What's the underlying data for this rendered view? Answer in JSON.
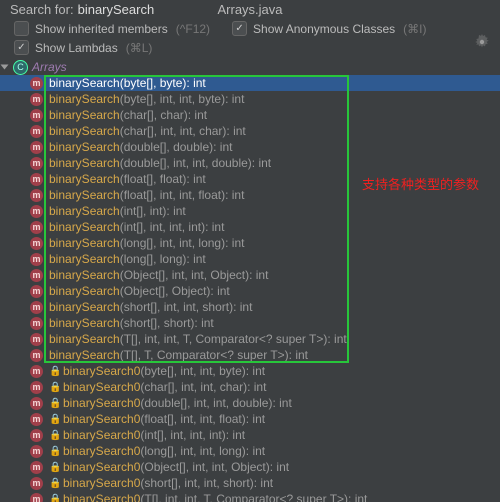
{
  "header": {
    "search_label": "Search for:",
    "search_value": "binarySearch",
    "file_name": "Arrays.java"
  },
  "options": {
    "show_inherited": {
      "label": "Show inherited members",
      "hint": "(^F12)",
      "checked": false
    },
    "show_lambdas": {
      "label": "Show Lambdas",
      "hint": "(⌘L)",
      "checked": true
    },
    "show_anonymous": {
      "label": "Show Anonymous Classes",
      "hint": "(⌘I)",
      "checked": true
    }
  },
  "class_name": "Arrays",
  "annotation": "支持各种类型的参数",
  "methods_group_a": [
    {
      "name": "binarySearch",
      "sig": "(byte[], byte): int",
      "selected": true
    },
    {
      "name": "binarySearch",
      "sig": "(byte[], int, int, byte): int"
    },
    {
      "name": "binarySearch",
      "sig": "(char[], char): int"
    },
    {
      "name": "binarySearch",
      "sig": "(char[], int, int, char): int"
    },
    {
      "name": "binarySearch",
      "sig": "(double[], double): int"
    },
    {
      "name": "binarySearch",
      "sig": "(double[], int, int, double): int"
    },
    {
      "name": "binarySearch",
      "sig": "(float[], float): int"
    },
    {
      "name": "binarySearch",
      "sig": "(float[], int, int, float): int"
    },
    {
      "name": "binarySearch",
      "sig": "(int[], int): int"
    },
    {
      "name": "binarySearch",
      "sig": "(int[], int, int, int): int"
    },
    {
      "name": "binarySearch",
      "sig": "(long[], int, int, long): int"
    },
    {
      "name": "binarySearch",
      "sig": "(long[], long): int"
    },
    {
      "name": "binarySearch",
      "sig": "(Object[], int, int, Object): int"
    },
    {
      "name": "binarySearch",
      "sig": "(Object[], Object): int"
    },
    {
      "name": "binarySearch",
      "sig": "(short[], int, int, short): int"
    },
    {
      "name": "binarySearch",
      "sig": "(short[], short): int"
    },
    {
      "name": "binarySearch",
      "sig": "(T[], int, int, T, Comparator<? super T>): int"
    },
    {
      "name": "binarySearch",
      "sig": "(T[], T, Comparator<? super T>): int"
    }
  ],
  "methods_group_b": [
    {
      "name": "binarySearch0",
      "sig": "(byte[], int, int, byte): int"
    },
    {
      "name": "binarySearch0",
      "sig": "(char[], int, int, char): int"
    },
    {
      "name": "binarySearch0",
      "sig": "(double[], int, int, double): int"
    },
    {
      "name": "binarySearch0",
      "sig": "(float[], int, int, float): int"
    },
    {
      "name": "binarySearch0",
      "sig": "(int[], int, int, int): int"
    },
    {
      "name": "binarySearch0",
      "sig": "(long[], int, int, long): int"
    },
    {
      "name": "binarySearch0",
      "sig": "(Object[], int, int, Object): int"
    },
    {
      "name": "binarySearch0",
      "sig": "(short[], int, int, short): int"
    },
    {
      "name": "binarySearch0",
      "sig": "(T[], int, int, T, Comparator<? super T>): int"
    }
  ]
}
